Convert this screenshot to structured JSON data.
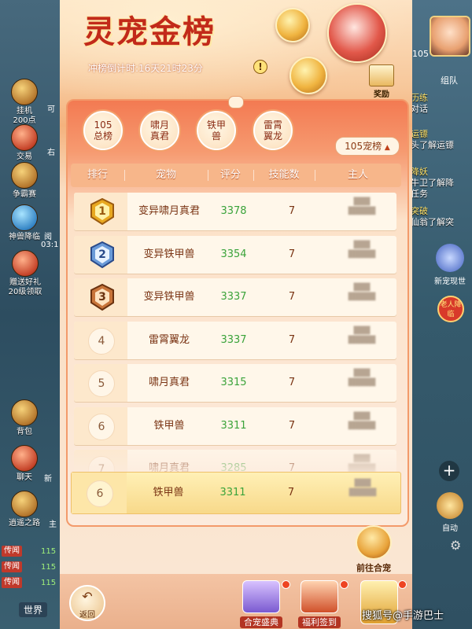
{
  "background_left": {
    "buttons": [
      "挂机\n200点",
      "交易",
      "争霸赛",
      "神兽降临",
      "赠送好礼\n20级领取",
      "背包",
      "聊天",
      "逍遥之路"
    ],
    "partial_labels": [
      "可",
      "右",
      "阅",
      "03:1",
      "新",
      "主"
    ],
    "tags": [
      "传闻",
      "传闻",
      "传闻"
    ],
    "numbers": [
      "115",
      "115",
      "115"
    ],
    "world_label": "世界"
  },
  "background_right": {
    "level": "105",
    "team_label": "组队",
    "texts": [
      {
        "t": "历练",
        "c": "y"
      },
      {
        "t": "对话",
        "c": "w"
      },
      {
        "t": "运镖",
        "c": "y"
      },
      {
        "t": "头了解运镖",
        "c": "w"
      },
      {
        "t": "降妖",
        "c": "y"
      },
      {
        "t": "牛卫了解降",
        "c": "w"
      },
      {
        "t": "任务",
        "c": "w"
      },
      {
        "t": "突破",
        "c": "y"
      },
      {
        "t": "仙翁了解突",
        "c": "w"
      }
    ],
    "side_labels": [
      "新宠现世",
      "老人降临",
      "自动"
    ]
  },
  "header": {
    "title": "灵宠金榜",
    "countdown": "冲榜倒计时:16天21时23分",
    "info": "!",
    "reward_label": "奖励"
  },
  "categories": [
    {
      "label": "105\n总榜",
      "active": true
    },
    {
      "label": "啸月\n真君",
      "active": false
    },
    {
      "label": "铁甲\n兽",
      "active": false
    },
    {
      "label": "雷霄\n翼龙",
      "active": false
    }
  ],
  "dropdown": {
    "value": "105宠榜",
    "caret": "▲"
  },
  "table": {
    "columns": [
      "排行",
      "宠物",
      "评分",
      "技能数",
      "主人"
    ],
    "rows": [
      {
        "rank": "1",
        "badge": "gold",
        "pet": "变异啸月真君",
        "score": "3378",
        "skills": "7"
      },
      {
        "rank": "2",
        "badge": "silver",
        "pet": "变异铁甲兽",
        "score": "3354",
        "skills": "7"
      },
      {
        "rank": "3",
        "badge": "bronze",
        "pet": "变异铁甲兽",
        "score": "3337",
        "skills": "7"
      },
      {
        "rank": "4",
        "badge": "",
        "pet": "雷霄翼龙",
        "score": "3337",
        "skills": "7"
      },
      {
        "rank": "5",
        "badge": "",
        "pet": "啸月真君",
        "score": "3315",
        "skills": "7"
      },
      {
        "rank": "6",
        "badge": "",
        "pet": "铁甲兽",
        "score": "3311",
        "skills": "7"
      },
      {
        "rank": "7",
        "badge": "",
        "pet": "啸月真君",
        "score": "3285",
        "skills": "7"
      }
    ],
    "my_row": {
      "rank": "6",
      "pet": "铁甲兽",
      "score": "3311",
      "skills": "7"
    }
  },
  "goto_button": "前往合宠",
  "bottom": {
    "back_label": "返回",
    "buttons": [
      "合宠盛典",
      "福利签到",
      ""
    ]
  },
  "watermark": "搜狐号@手游巴士"
}
